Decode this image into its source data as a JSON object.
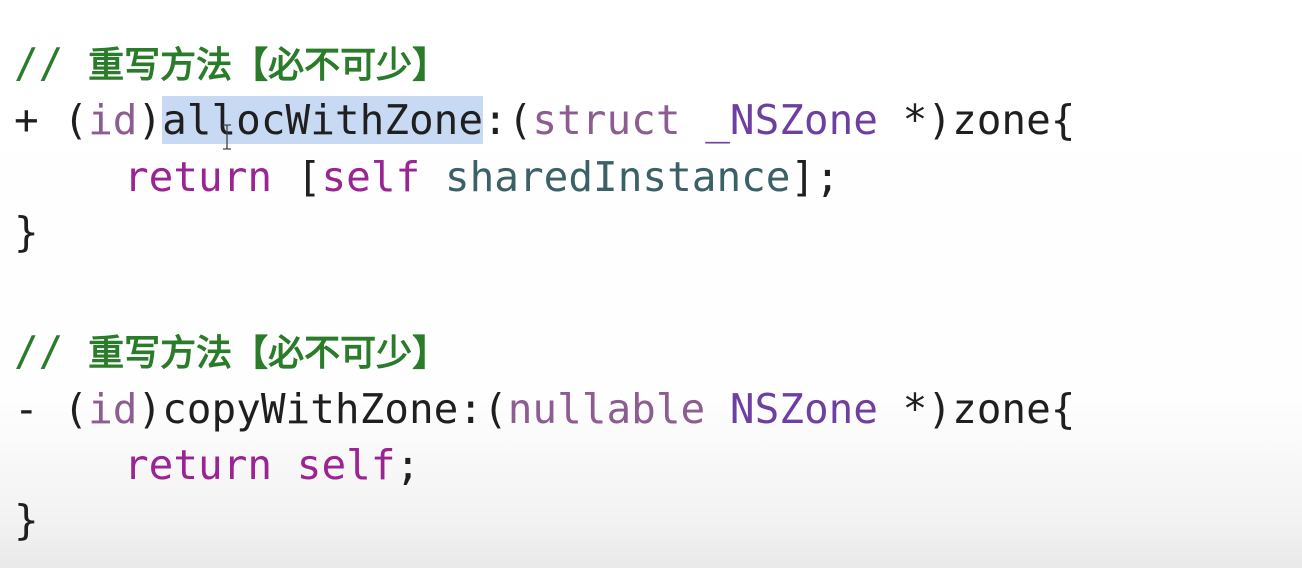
{
  "code": {
    "block1": {
      "comment_prefix": "// ",
      "comment_text": "重写方法【必不可少】",
      "signature": {
        "sign": "+ ",
        "open_paren": "(",
        "return_type": "id",
        "close_paren": ")",
        "method_name": "allocWithZone",
        "colon_paren": ":(",
        "struct_kw": "struct",
        "param_type": " _NSZone",
        "pointer": " *)",
        "param_name": "zone{"
      },
      "body": {
        "return_kw": "return",
        "open_bracket": " [",
        "self_kw": "self",
        "message": " sharedInstance",
        "close": "];"
      },
      "closing_brace": "}"
    },
    "block2": {
      "comment_prefix": "// ",
      "comment_text": "重写方法【必不可少】",
      "signature": {
        "sign": "- ",
        "open_paren": "(",
        "return_type": "id",
        "close_paren": ")",
        "method_name": "copyWithZone",
        "colon_paren": ":(",
        "nullable_kw": "nullable",
        "param_type": " NSZone",
        "pointer": " *)",
        "param_name": "zone{"
      },
      "body": {
        "return_kw": "return",
        "space": " ",
        "self_kw": "self",
        "semicolon": ";"
      },
      "closing_brace": "}"
    },
    "selection": "allocWithZone",
    "cursor_icon": "i-beam-cursor-icon"
  },
  "colors": {
    "comment": "#2a7c2a",
    "keyword": "#9b2393",
    "type": "#6e3fa0",
    "identifier": "#3b6066",
    "selection": "#c8daf3"
  }
}
